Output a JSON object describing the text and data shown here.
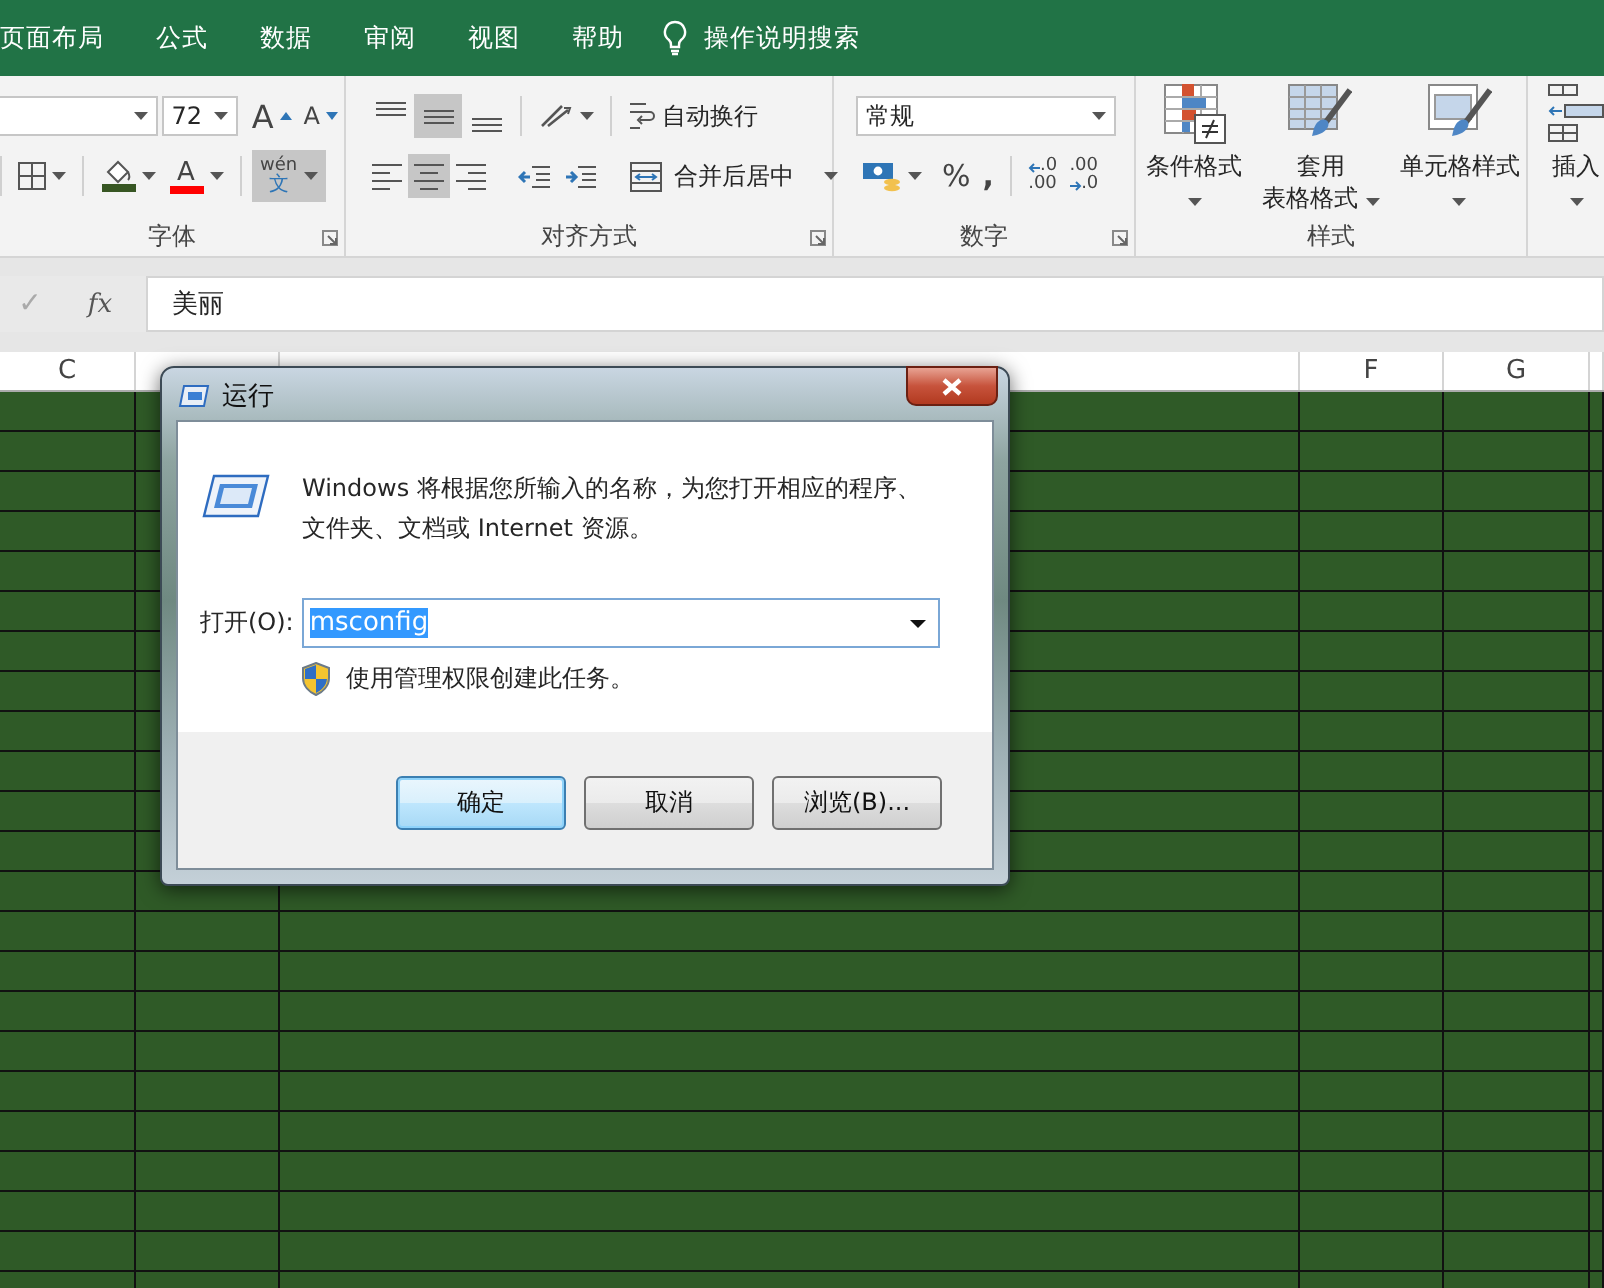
{
  "ribbon_tabs": [
    {
      "label": "页面布局",
      "selected": false
    },
    {
      "label": "公式",
      "selected": false
    },
    {
      "label": "数据",
      "selected": false
    },
    {
      "label": "审阅",
      "selected": false
    },
    {
      "label": "视图",
      "selected": false
    },
    {
      "label": "帮助",
      "selected": false
    }
  ],
  "tell_me": "操作说明搜索",
  "font_group": {
    "label": "字体",
    "font_size": "72",
    "grow_label": "A",
    "shrink_label": "A",
    "font_color_label": "A",
    "phonetic": {
      "pinyin": "wén",
      "char": "文",
      "pressed": true
    }
  },
  "alignment_group": {
    "label": "对齐方式",
    "buttons": [
      {
        "kind": "top",
        "pressed": false
      },
      {
        "kind": "middle",
        "pressed": true
      },
      {
        "kind": "bottom",
        "pressed": false
      },
      {
        "kind": "left",
        "pressed": false
      },
      {
        "kind": "center",
        "pressed": true
      },
      {
        "kind": "right",
        "pressed": false
      }
    ],
    "wrap_text": "自动换行",
    "merge_center": "合并后居中"
  },
  "number_group": {
    "label": "数字",
    "format": "常规",
    "percent": "%",
    "comma": ",",
    "increase_decimal": [
      ".0",
      ".00"
    ],
    "decrease_decimal": [
      ".00",
      ".0"
    ]
  },
  "styles_group": {
    "label": "样式",
    "buttons": [
      {
        "kind": "conditional",
        "lines": [
          "条件格式"
        ]
      },
      {
        "kind": "table",
        "lines": [
          "套用",
          "表格格式"
        ]
      },
      {
        "kind": "cell",
        "lines": [
          "单元格样式"
        ]
      }
    ]
  },
  "cells_group": {
    "insert": "插入"
  },
  "formula_bar": {
    "confirm": "✓",
    "fx": "fx",
    "value": "美丽"
  },
  "columns": [
    {
      "label": "C"
    },
    {
      "label": "F"
    },
    {
      "label": "G"
    }
  ],
  "run_dialog": {
    "title": "运行",
    "message_lines": [
      "Windows 将根据您所输入的名称，为您打开相应的程序、",
      "文件夹、文档或 Internet 资源。"
    ],
    "open_label": "打开(O):",
    "value": "msconfig",
    "text_selected": true,
    "admin_note": "使用管理权限创建此任务。",
    "buttons": [
      {
        "label": "确定",
        "default": true
      },
      {
        "label": "取消",
        "default": false
      },
      {
        "label": "浏览(B)...",
        "default": false
      }
    ]
  }
}
